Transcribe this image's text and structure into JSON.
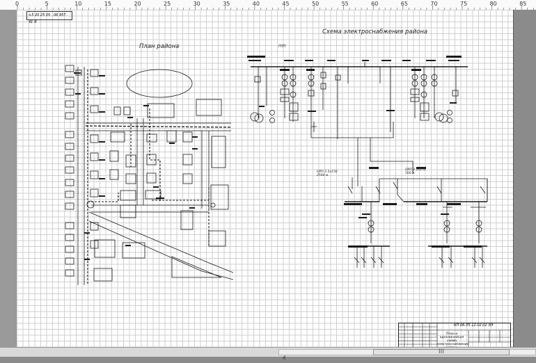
{
  "ruler": {
    "labels": [
      "0",
      "5",
      "10",
      "15",
      "20",
      "25",
      "30",
      "35",
      "40",
      "45",
      "50",
      "55",
      "60",
      "65",
      "70",
      "75",
      "80",
      "85"
    ]
  },
  "stamp": {
    "text": "+5 20 25 05 . 06 957 . 41 Я"
  },
  "plan": {
    "title": "План района"
  },
  "scheme": {
    "title": "Схема электроснабжения района"
  },
  "cable_labels": {
    "left": "ОРП-3 2х150 2500 м",
    "right": "ОРП-2 2х150 500 м",
    "top": "ГПП"
  },
  "titleblock": {
    "code": "КП 06.Л5 12.02.02 ЭЭ",
    "name": "План и однолинейная схема электроснабжения района"
  },
  "scrollbar": {
    "grip": "III"
  },
  "colors": {
    "sheet": "#ffffff",
    "grid": "#cfcfcf",
    "ink": "#1a1a1a",
    "background": "#8b8b8b"
  }
}
